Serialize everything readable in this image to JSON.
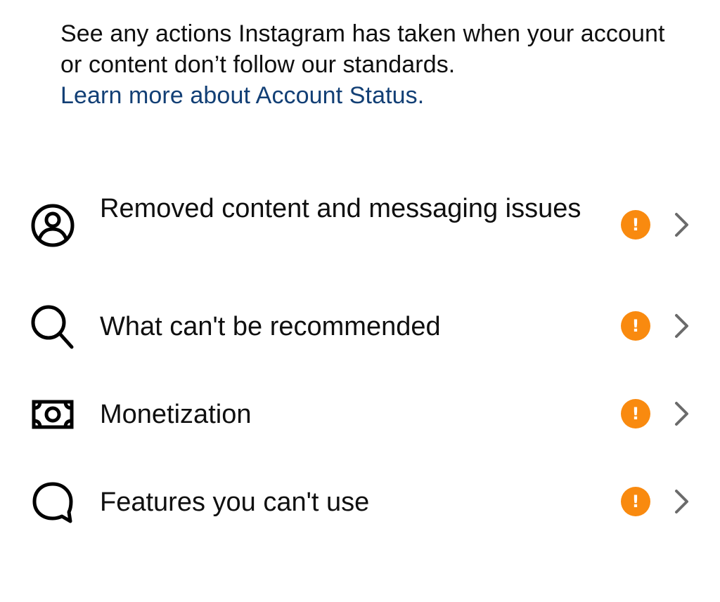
{
  "intro": {
    "text": "See any actions Instagram has taken when your account or content don’t follow our standards.",
    "link": "Learn more about Account Status."
  },
  "rows": [
    {
      "label": "Removed content and messaging issues",
      "icon": "profile-circle-icon",
      "badge": "!"
    },
    {
      "label": "What can't be recommended",
      "icon": "search-icon",
      "badge": "!"
    },
    {
      "label": "Monetization",
      "icon": "money-icon",
      "badge": "!"
    },
    {
      "label": "Features you can't use",
      "icon": "chat-bubble-icon",
      "badge": "!"
    }
  ],
  "colors": {
    "text": "#0f0f0f",
    "link": "#123f75",
    "warning": "#f98a0f",
    "chevron": "#6b6b6b",
    "background": "#ffffff"
  }
}
